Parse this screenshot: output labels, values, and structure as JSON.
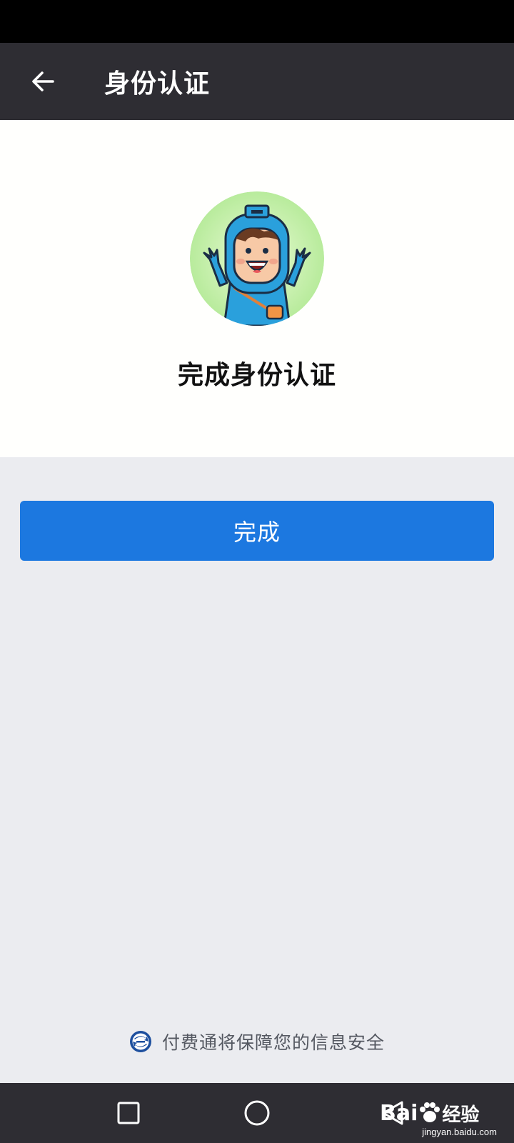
{
  "header": {
    "title": "身份认证",
    "back_icon": "arrow-left-icon"
  },
  "hero": {
    "avatar_icon": "mascot-avatar-icon",
    "title": "完成身份认证"
  },
  "actions": {
    "done_label": "完成"
  },
  "footer": {
    "security_text": "付费通将保障您的信息安全",
    "security_icon": "fufeitong-logo-icon"
  },
  "navigation": {
    "recents_icon": "square-recents-icon",
    "home_icon": "circle-home-icon",
    "back_icon": "triangle-back-icon"
  },
  "watermark": {
    "brand": "Bai",
    "brand_suffix": "经验",
    "site": "jingyan.baidu.com"
  },
  "colors": {
    "app_bar": "#2e2d33",
    "accent": "#1c78e0",
    "page_bg": "#ebecf0",
    "card_bg": "#fffffd"
  }
}
